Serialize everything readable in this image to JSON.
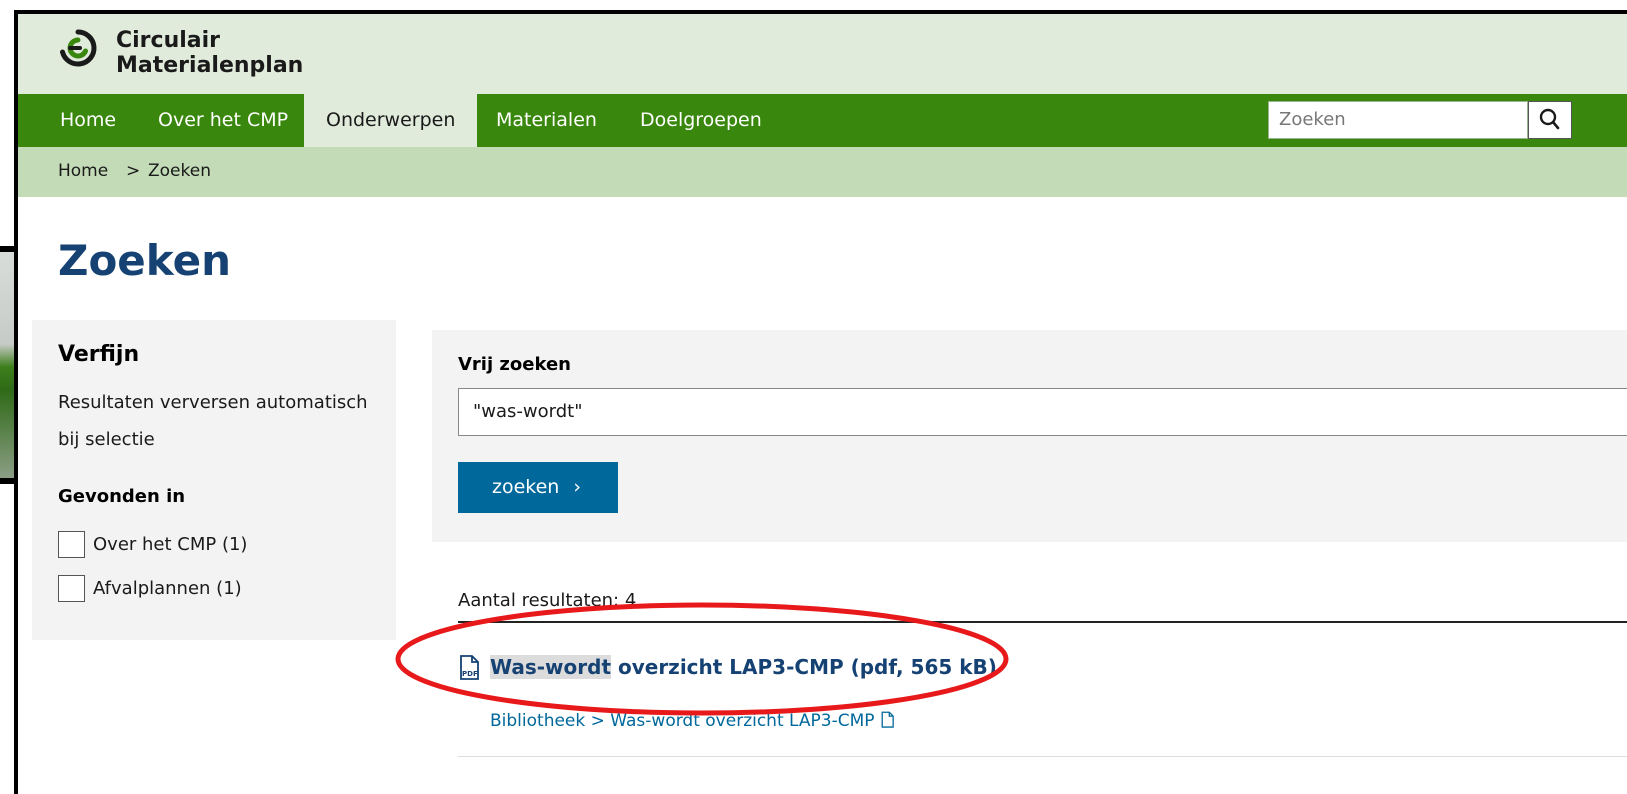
{
  "brand": {
    "line1": "Circulair",
    "line2": "Materialenplan"
  },
  "nav": {
    "items": [
      {
        "label": "Home"
      },
      {
        "label": "Over het CMP"
      },
      {
        "label": "Onderwerpen"
      },
      {
        "label": "Materialen"
      },
      {
        "label": "Doelgroepen"
      }
    ],
    "active": "Onderwerpen",
    "search_placeholder": "Zoeken"
  },
  "breadcrumb": {
    "home": "Home",
    "separator": ">",
    "current": "Zoeken"
  },
  "page": {
    "title": "Zoeken"
  },
  "refine": {
    "title": "Verfijn",
    "description": "Resultaten verversen automatisch bij selectie",
    "found_in_title": "Gevonden in",
    "options": [
      {
        "label": "Over het CMP (1)",
        "checked": false
      },
      {
        "label": "Afvalplannen (1)",
        "checked": false
      }
    ]
  },
  "search": {
    "label": "Vrij zoeken",
    "value": "\"was-wordt\"",
    "button_label": "zoeken",
    "button_chevron": "›"
  },
  "results": {
    "count_label": "Aantal resultaten: 4",
    "items": [
      {
        "title_highlight": "Was-wordt",
        "title_rest": " overzicht LAP3-CMP (pdf, 565 kB)",
        "path_root": "Bibliotheek",
        "path_separator": ">",
        "path_leaf": "Was-wordt overzicht LAP3-CMP"
      }
    ]
  },
  "colors": {
    "nav_green": "#39870c",
    "brand_bg": "#e0ebdb",
    "crumb_bg": "#c3dbb6",
    "title_blue": "#154273",
    "button_blue": "#01689b",
    "annotation_red": "#e8191a"
  },
  "icons": {
    "search": "magnifier-icon",
    "pdf": "pdf-file-icon",
    "logo": "circular-arrows-logo"
  }
}
